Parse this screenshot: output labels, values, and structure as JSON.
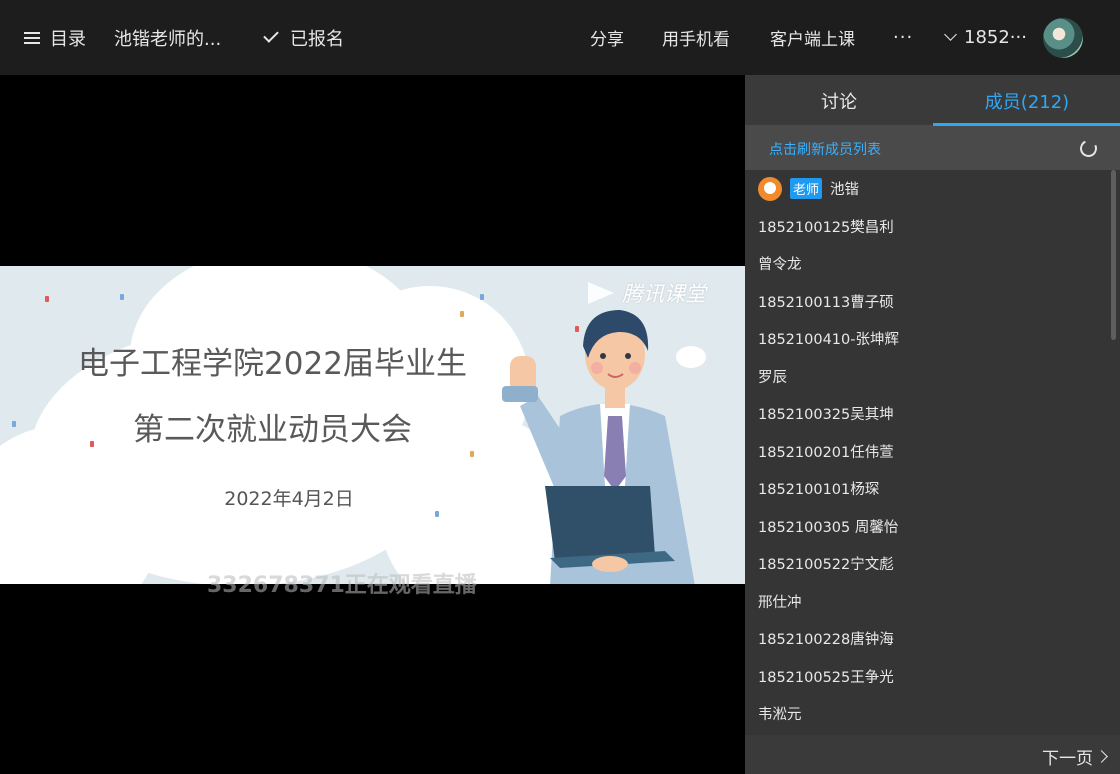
{
  "header": {
    "menu_label": "目录",
    "course_title": "池锴老师的...",
    "enrolled_label": "已报名",
    "share_label": "分享",
    "mobile_label": "用手机看",
    "client_label": "客户端上课",
    "more_label": "···",
    "user_label": "1852···"
  },
  "video": {
    "brand": "腾讯课堂",
    "slide_title_1": "电子工程学院2022届毕业生",
    "slide_title_2": "第二次就业动员大会",
    "slide_date": "2022年4月2日",
    "watch_overlay": "332678371正在观看直播"
  },
  "panel": {
    "tab_discuss": "讨论",
    "tab_members": "成员(212)",
    "refresh_label": "点击刷新成员列表",
    "teacher_badge": "老师",
    "teacher_name": "池锴",
    "members": [
      "1852100125樊昌利",
      "曾令龙",
      "1852100113曹子硕",
      "1852100410-张坤辉",
      "罗辰",
      "1852100325吴其坤",
      "1852100201任伟萱",
      "1852100101杨琛",
      "1852100305 周馨怡",
      "1852100522宁文彪",
      "邢仕冲",
      "1852100228唐钟海",
      "1852100525王争光",
      "韦淞元"
    ],
    "next_page": "下一页"
  },
  "colors": {
    "accent": "#2ea8f5",
    "topbar_bg": "#1d1d1e",
    "panel_bg": "#3a3a3a"
  }
}
